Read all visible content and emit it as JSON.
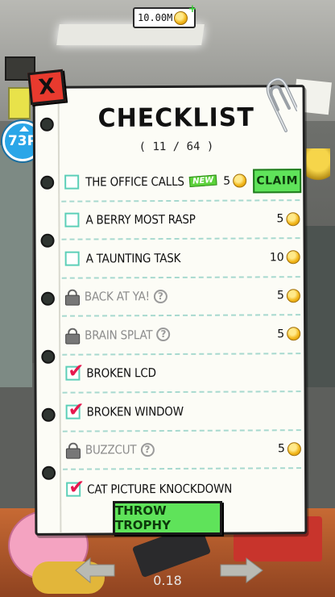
{
  "currency": {
    "amount": "10.00M"
  },
  "level": {
    "label": "73P"
  },
  "checklist": {
    "title": "CHECKLIST",
    "progress": "( 11 / 64 )",
    "items": [
      {
        "label": "THE OFFICE CALLS",
        "state": "unchecked",
        "badge": "NEW",
        "reward": "5",
        "action": "CLAIM"
      },
      {
        "label": "A BERRY MOST RASP",
        "state": "unchecked",
        "reward": "5"
      },
      {
        "label": "A TAUNTING TASK",
        "state": "unchecked",
        "reward": "10"
      },
      {
        "label": "BACK AT YA!",
        "state": "locked",
        "reward": "5"
      },
      {
        "label": "BRAIN SPLAT",
        "state": "locked",
        "reward": "5"
      },
      {
        "label": "BROKEN LCD",
        "state": "checked"
      },
      {
        "label": "BROKEN WINDOW",
        "state": "checked"
      },
      {
        "label": "BUZZCUT",
        "state": "locked",
        "reward": "5"
      },
      {
        "label": "CAT PICTURE KNOCKDOWN",
        "state": "checked"
      }
    ]
  },
  "close": {
    "label": "X"
  },
  "throw_button": {
    "label": "THROW TROPHY"
  },
  "version": "0.18",
  "colors": {
    "accent_green": "#5fe35a",
    "close_red": "#e83a2e",
    "check_pink": "#e6184e",
    "box_teal": "#5ccfb8",
    "level_blue": "#2aa6e8"
  }
}
